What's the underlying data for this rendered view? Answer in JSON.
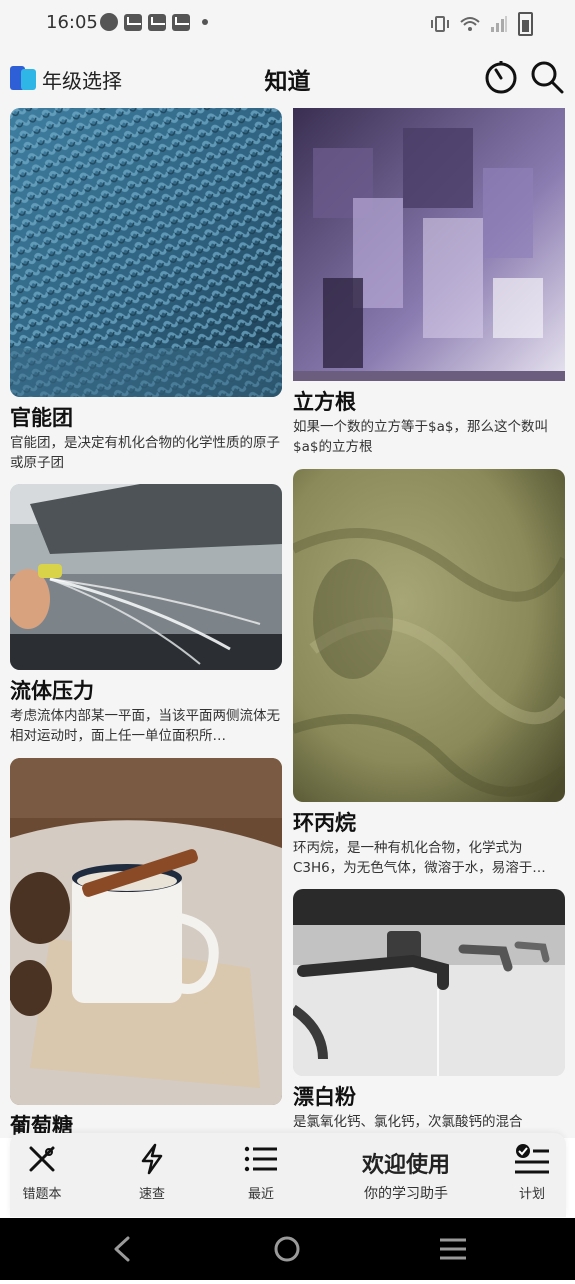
{
  "status_bar": {
    "time": "16:05"
  },
  "header": {
    "grade_label": "年级选择",
    "app_title": "知道"
  },
  "cards": [
    {
      "title": "官能团",
      "desc": "官能团，是决定有机化合物的化学性质的原子或原子团"
    },
    {
      "title": "立方根",
      "desc": "如果一个数的立方等于$a$，那么这个数叫$a$的立方根"
    },
    {
      "title": "流体压力",
      "desc": "考虑流体内部某一平面，当该平面两侧流体无相对运动时，面上任一单位面积所…"
    },
    {
      "title": "环丙烷",
      "desc": "环丙烷，是一种有机化合物，化学式为C3H6，为无色气体，微溶于水，易溶于…"
    },
    {
      "title": "葡萄糖",
      "desc": ""
    },
    {
      "title": "漂白粉",
      "desc": "是氯氧化钙、氯化钙，次氯酸钙的混合"
    }
  ],
  "bottom_nav": {
    "wrong_book": "错题本",
    "quick_check": "速查",
    "recent": "最近",
    "welcome_title": "欢迎使用",
    "welcome_sub": "你的学习助手",
    "plan": "计划"
  },
  "colors": {
    "background": "#f5f5f5",
    "accent": "#2f7be6",
    "text": "#111111"
  }
}
